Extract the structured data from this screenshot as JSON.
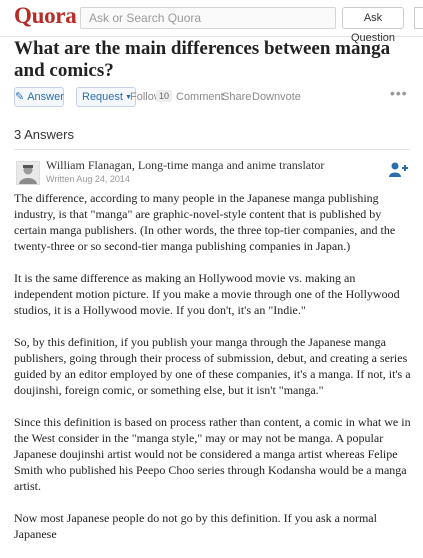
{
  "header": {
    "logo": "Quora",
    "search_placeholder": "Ask or Search Quora",
    "ask_button": "Ask Question"
  },
  "question": {
    "title": "What are the main differences between manga and comics?",
    "actions": {
      "answer": "Answer",
      "request": "Request",
      "follow": "Follow",
      "follow_count": "10",
      "comment": "Comment",
      "share": "Share",
      "downvote": "Downvote",
      "more": "•••"
    }
  },
  "answers_count": "3 Answers",
  "answer": {
    "author": "William Flanagan, Long-time manga and anime translator",
    "date": "Written Aug 24, 2014",
    "paragraphs": [
      "The difference, according to many people in the Japanese manga publishing industry, is that \"manga\" are graphic-novel-style content that is published by certain manga publishers. (In other words, the three top-tier companies, and the twenty-three or so second-tier manga publishing companies in Japan.)",
      "It is the same difference as making an Hollywood movie vs. making an independent motion picture. If you make a movie through one of the Hollywood studios, it is a Hollywood movie. If you don't, it's an \"Indie.\"",
      "So, by this definition, if you publish your manga through the Japanese manga publishers, going through their process of submission, debut, and creating a series guided by an editor employed by one of these companies, it's a manga. If not, it's a doujinshi, foreign comic, or something else, but it isn't \"manga.\"",
      "Since this definition is based on process rather than content, a comic in what we in the West consider in the \"manga style,\" may or may not be manga. A popular Japanese doujinshi artist would not be considered a manga artist whereas Felipe Smith who published his Peepo Choo series through Kodansha would be a manga artist.",
      "Now most Japanese people do not go by this definition. If you ask a normal Japanese"
    ]
  },
  "colors": {
    "brand": "#b92b27",
    "link_blue": "#2b6dad",
    "muted": "#8a8a8a"
  },
  "icons": {
    "answer": "pencil-icon",
    "request": "caret-down-icon",
    "more": "ellipsis-icon",
    "avatar": "user-avatar",
    "add_user": "add-user-icon"
  }
}
